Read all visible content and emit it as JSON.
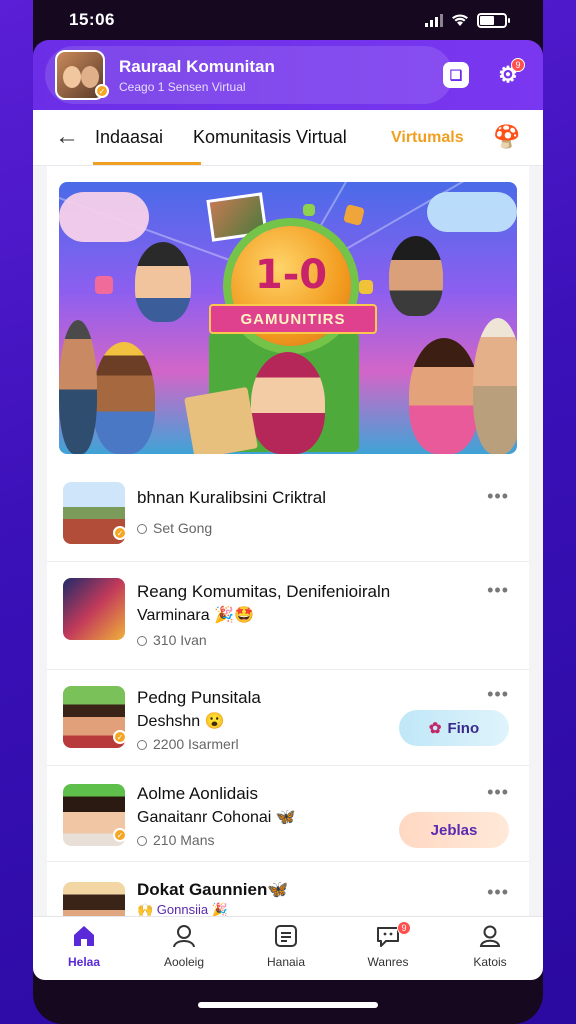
{
  "status_bar": {
    "time": "15:06"
  },
  "header": {
    "title": "Rauraal Komunitan",
    "subtitle": "Ceago 1 Sensen Virtual",
    "notification_count": "9"
  },
  "tabs": [
    {
      "label": "Indaasai",
      "active": true
    },
    {
      "label": "Komunitasis Virtual",
      "active": false
    },
    {
      "label": "Virtumals",
      "active": false
    }
  ],
  "banner": {
    "badge_text": "1-0",
    "ribbon_text": "GAMUNITIRS"
  },
  "list": [
    {
      "title": "bhnan Kuralibsini Criktral",
      "line2": "",
      "meta": "Set Gong",
      "action": ""
    },
    {
      "title": "Reang Komumitas, Denifenioiraln",
      "line2": "Varminara 🎉🤩",
      "meta": "310 Ivan",
      "action": ""
    },
    {
      "title": "Pedng Punsitala",
      "line2": "Deshshn 😮",
      "meta": "2200 Isarmerl",
      "action": "Fino"
    },
    {
      "title": "Aolme Aonlidais",
      "line2": "Ganaitanr Cohonai 🦋",
      "meta": "210 Mans",
      "action": "Jeblas"
    },
    {
      "title": "Dokat Gaunnien🦋",
      "line2": "🙌 Gonnsiia 🎉",
      "meta": "",
      "action": ""
    }
  ],
  "bottom_nav": [
    {
      "label": "Helaa",
      "icon": "home-icon",
      "active": true
    },
    {
      "label": "Aooleig",
      "icon": "profile-icon",
      "active": false
    },
    {
      "label": "Hanaia",
      "icon": "document-icon",
      "active": false
    },
    {
      "label": "Wanres",
      "icon": "chat-icon",
      "active": false,
      "badge": "9"
    },
    {
      "label": "Katois",
      "icon": "user-icon",
      "active": false
    }
  ],
  "colors": {
    "brand": "#6b2ee6",
    "accent": "#f0a020",
    "nav_active": "#5a2ad8"
  }
}
